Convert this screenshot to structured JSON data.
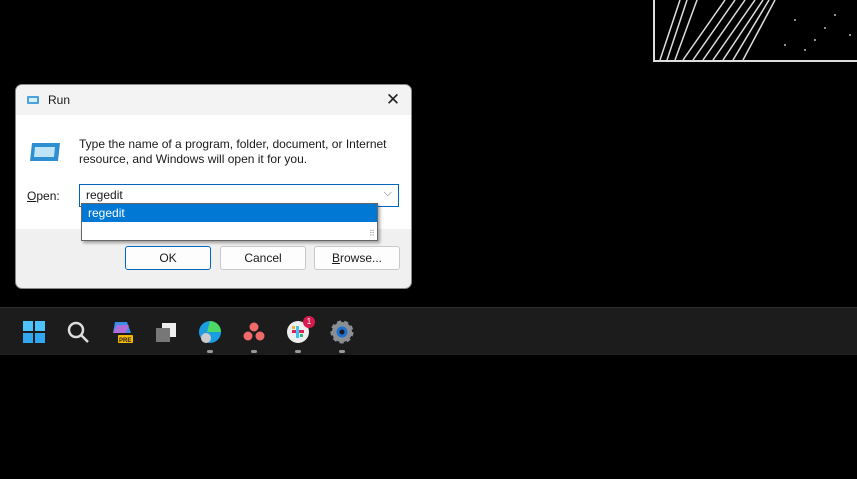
{
  "dialog": {
    "title": "Run",
    "description": "Type the name of a program, folder, document, or Internet resource, and Windows will open it for you.",
    "open_label_accel": "O",
    "open_label_rest": "pen:",
    "input_value": "regedit",
    "dropdown_options": [
      "regedit"
    ],
    "ok_label": "OK",
    "cancel_label": "Cancel",
    "browse_label_accel": "B",
    "browse_label_rest": "rowse..."
  },
  "taskbar": {
    "items": [
      {
        "icon": "start-icon"
      },
      {
        "icon": "search-icon"
      },
      {
        "icon": "copilot-icon",
        "tag": "PRE"
      },
      {
        "icon": "task-view-icon"
      },
      {
        "icon": "edge-icon"
      },
      {
        "icon": "asana-icon"
      },
      {
        "icon": "slack-icon",
        "badge": "1"
      },
      {
        "icon": "settings-icon"
      }
    ]
  },
  "colors": {
    "accent": "#0078d4",
    "taskbar": "#1c1c1c",
    "badge": "#d81b4f"
  }
}
